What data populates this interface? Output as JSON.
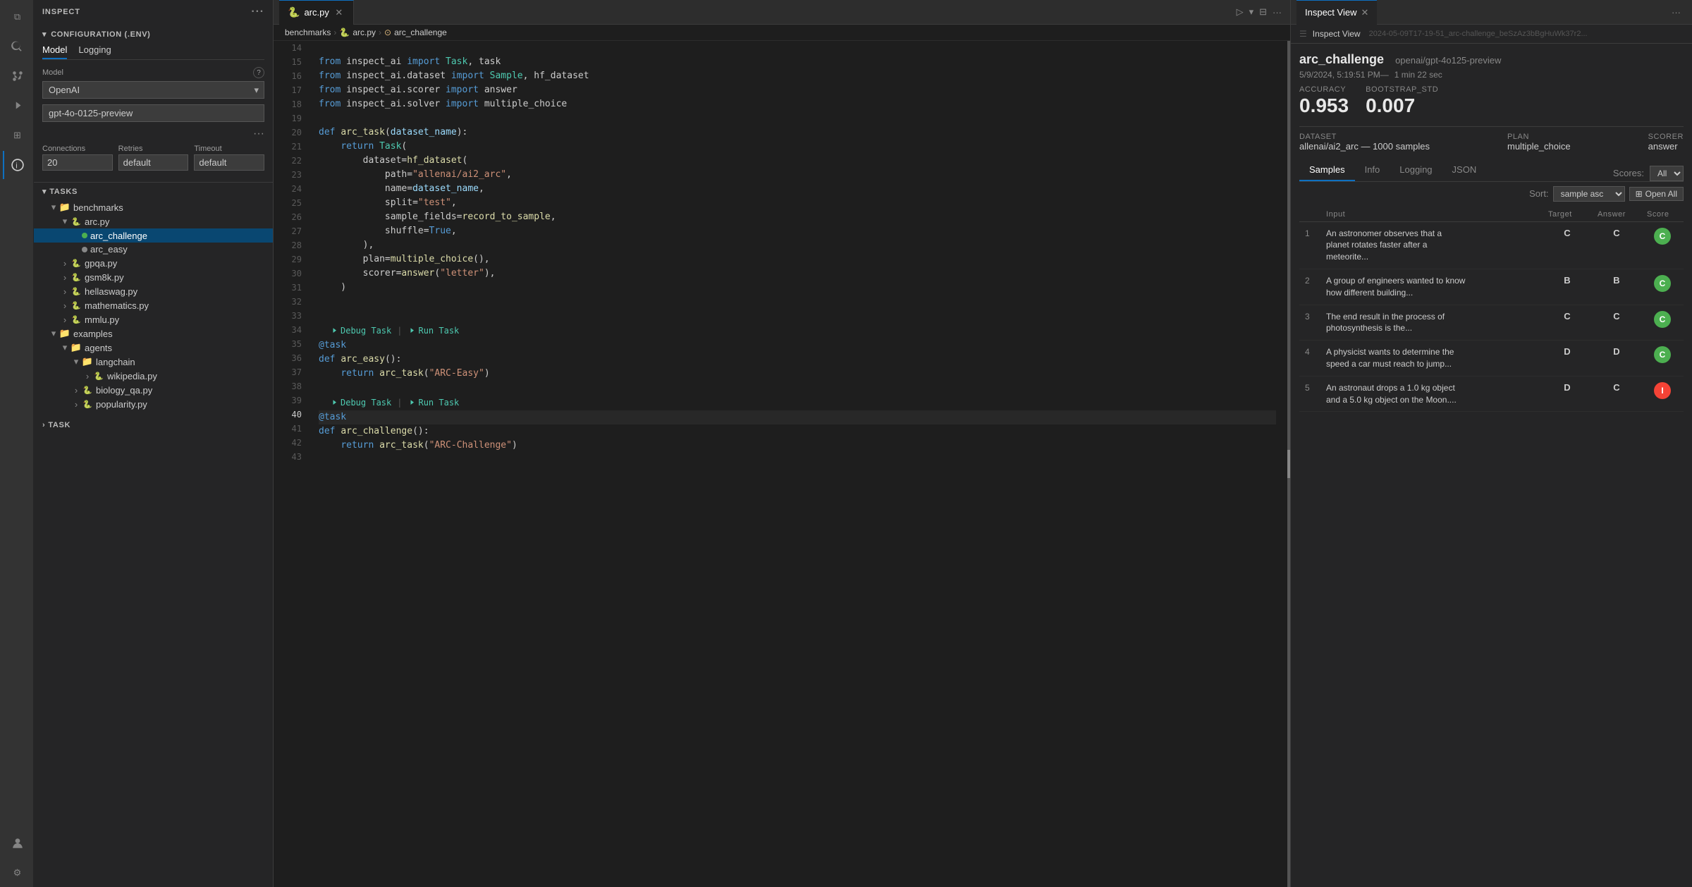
{
  "iconBar": {
    "items": [
      {
        "name": "explorer-icon",
        "icon": "⧉",
        "active": false
      },
      {
        "name": "search-icon",
        "icon": "🔍",
        "active": false
      },
      {
        "name": "source-control-icon",
        "icon": "⑂",
        "active": false
      },
      {
        "name": "run-icon",
        "icon": "▷",
        "active": false
      },
      {
        "name": "extensions-icon",
        "icon": "⊞",
        "active": false
      },
      {
        "name": "inspect-icon",
        "icon": "ⓘ",
        "active": true
      }
    ]
  },
  "sidebar": {
    "title": "INSPECT",
    "configSection": {
      "header": "CONFIGURATION (.ENV)",
      "tabs": [
        "Model",
        "Logging"
      ],
      "activeTab": "Model",
      "modelLabel": "Model",
      "modelValue": "OpenAI",
      "modelInput": "gpt-4o-0125-preview",
      "connections": {
        "label": "Connections",
        "value": "20"
      },
      "retries": {
        "label": "Retries",
        "value": "default"
      },
      "timeout": {
        "label": "Timeout",
        "value": "default"
      }
    },
    "tasksHeader": "TASKS",
    "tree": [
      {
        "id": "benchmarks",
        "label": "benchmarks",
        "level": 1,
        "type": "folder",
        "expanded": true
      },
      {
        "id": "arc-py",
        "label": "arc.py",
        "level": 2,
        "type": "file",
        "expanded": true
      },
      {
        "id": "arc-challenge",
        "label": "arc_challenge",
        "level": 3,
        "type": "task",
        "selected": true
      },
      {
        "id": "arc-easy",
        "label": "arc_easy",
        "level": 3,
        "type": "task"
      },
      {
        "id": "gpqa-py",
        "label": "gpqa.py",
        "level": 2,
        "type": "file"
      },
      {
        "id": "gsm8k-py",
        "label": "gsm8k.py",
        "level": 2,
        "type": "file"
      },
      {
        "id": "hellaswag-py",
        "label": "hellaswag.py",
        "level": 2,
        "type": "file"
      },
      {
        "id": "mathematics-py",
        "label": "mathematics.py",
        "level": 2,
        "type": "file"
      },
      {
        "id": "mmlu-py",
        "label": "mmlu.py",
        "level": 2,
        "type": "file"
      },
      {
        "id": "examples",
        "label": "examples",
        "level": 1,
        "type": "folder",
        "expanded": true
      },
      {
        "id": "agents",
        "label": "agents",
        "level": 2,
        "type": "folder",
        "expanded": true
      },
      {
        "id": "langchain",
        "label": "langchain",
        "level": 3,
        "type": "folder",
        "expanded": true
      },
      {
        "id": "wikipedia-py",
        "label": "wikipedia.py",
        "level": 4,
        "type": "file"
      },
      {
        "id": "biology-py",
        "label": "biology_qa.py",
        "level": 3,
        "type": "file"
      },
      {
        "id": "popularity-py",
        "label": "popularity.py",
        "level": 3,
        "type": "file"
      }
    ],
    "taskHeader": "TASK"
  },
  "editor": {
    "tab": {
      "label": "arc.py",
      "icon": "🐍"
    },
    "breadcrumbs": [
      "benchmarks",
      "arc.py",
      "arc_challenge"
    ],
    "lines": [
      {
        "num": 14,
        "content": ""
      },
      {
        "num": 15,
        "content": "from_inspect_ai_import_Task_task"
      },
      {
        "num": 16,
        "content": "from_inspect_ai_dataset_import_Sample_hf_dataset"
      },
      {
        "num": 17,
        "content": "from_inspect_ai_scorer_import_answer"
      },
      {
        "num": 18,
        "content": "from_inspect_ai_solver_import_multiple_choice"
      },
      {
        "num": 19,
        "content": ""
      },
      {
        "num": 20,
        "content": "def_arc_task"
      },
      {
        "num": 21,
        "content": "return_Task"
      },
      {
        "num": 22,
        "content": "dataset_hf_dataset"
      },
      {
        "num": 23,
        "content": "path_allenai"
      },
      {
        "num": 24,
        "content": "name_dataset_name"
      },
      {
        "num": 25,
        "content": "split_test"
      },
      {
        "num": 26,
        "content": "sample_fields_record_to_sample"
      },
      {
        "num": 27,
        "content": "shuffle_True"
      },
      {
        "num": 28,
        "content": ""
      },
      {
        "num": 29,
        "content": "plan_multiple_choice"
      },
      {
        "num": 30,
        "content": "scorer_answer_letter"
      },
      {
        "num": 31,
        "content": ""
      },
      {
        "num": 32,
        "content": ""
      },
      {
        "num": 33,
        "content": ""
      },
      {
        "num": 34,
        "content": ""
      },
      {
        "num": 35,
        "content": "def_arc_easy"
      },
      {
        "num": 36,
        "content": "return_arc_task_ARC_Easy"
      },
      {
        "num": 37,
        "content": ""
      },
      {
        "num": 38,
        "content": ""
      },
      {
        "num": 39,
        "content": ""
      },
      {
        "num": 40,
        "content": "def_arc_challenge",
        "active": true
      },
      {
        "num": 41,
        "content": "return_arc_task_ARC_Challenge"
      },
      {
        "num": 42,
        "content": ""
      },
      {
        "num": 43,
        "content": ""
      }
    ]
  },
  "inspectView": {
    "tabLabel": "Inspect View",
    "breadcrumb": "Inspect View",
    "evalId": "2024-05-09T17-19-51_arc-challenge_beSzAz3bBgHuWk37r2...",
    "evalName": "arc_challenge",
    "modelName": "openai/gpt-4o125-preview",
    "timestamp": "5/9/2024, 5:19:51 PM—",
    "duration": "1 min 22 sec",
    "accuracy": {
      "label": "accuracy",
      "value": "0.953"
    },
    "bootstrap_std": {
      "label": "bootstrap_std",
      "value": "0.007"
    },
    "dataset": {
      "label": "DATASET",
      "value": "allenai/ai2_arc — 1000 samples"
    },
    "plan": {
      "label": "PLAN",
      "value": "multiple_choice"
    },
    "scorer": {
      "label": "SCORER",
      "value": "answer"
    },
    "subTabs": [
      "Samples",
      "Info",
      "Logging",
      "JSON"
    ],
    "activeSubTab": "Samples",
    "scoresLabel": "Scores:",
    "scoresValue": "All",
    "sortLabel": "Sort:",
    "sortValue": "sample asc",
    "openAllBtn": "⊞ Open All",
    "tableHeaders": [
      "Input",
      "Target",
      "Answer",
      "Score"
    ],
    "samples": [
      {
        "num": 1,
        "input": "An astronomer observes that a planet rotates faster after a meteorite...",
        "target": "C",
        "answer": "C",
        "score": "C",
        "scoreType": "green"
      },
      {
        "num": 2,
        "input": "A group of engineers wanted to know how different building...",
        "target": "B",
        "answer": "B",
        "score": "C",
        "scoreType": "green"
      },
      {
        "num": 3,
        "input": "The end result in the process of photosynthesis is the...",
        "target": "C",
        "answer": "C",
        "score": "C",
        "scoreType": "green"
      },
      {
        "num": 4,
        "input": "A physicist wants to determine the speed a car must reach to jump...",
        "target": "D",
        "answer": "D",
        "score": "C",
        "scoreType": "green"
      },
      {
        "num": 5,
        "input": "An astronaut drops a 1.0 kg object and a 5.0 kg object on the Moon....",
        "target": "D",
        "answer": "C",
        "score": "I",
        "scoreType": "red"
      }
    ]
  }
}
